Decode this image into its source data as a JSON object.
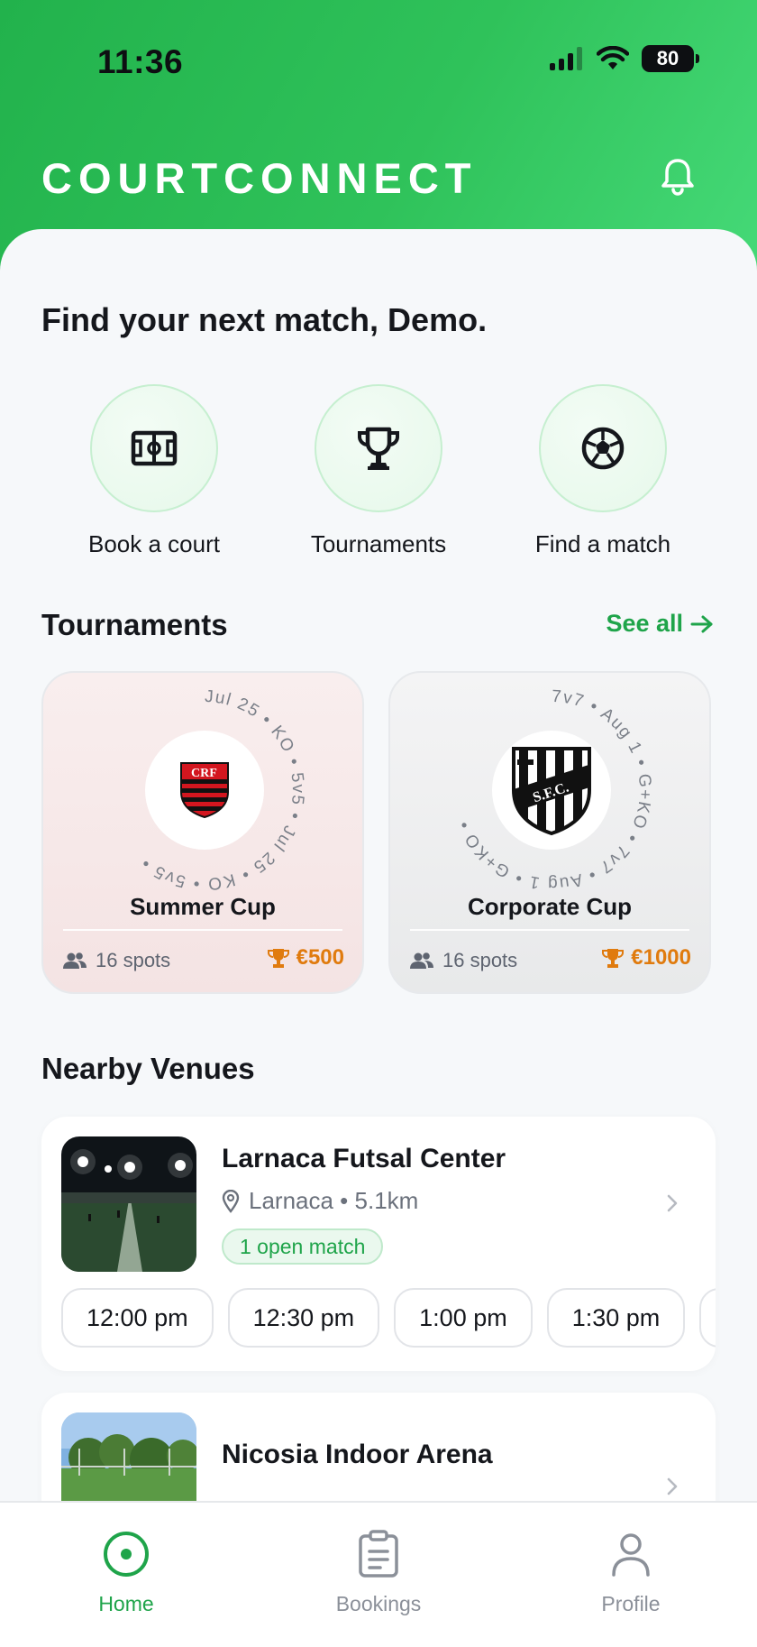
{
  "status": {
    "time": "11:36",
    "battery": "80"
  },
  "header": {
    "brand": "COURTCONNECT"
  },
  "greeting": "Find your next match, Demo.",
  "quick_actions": [
    {
      "label": "Book a court",
      "icon": "pitch-icon"
    },
    {
      "label": "Tournaments",
      "icon": "trophy-icon"
    },
    {
      "label": "Find a match",
      "icon": "soccer-ball-icon"
    }
  ],
  "tournaments_section": {
    "title": "Tournaments",
    "see_all": "See all"
  },
  "tournaments": [
    {
      "name": "Summer Cup",
      "ring_text": "Jul 25 • KO • 5v5 • Jul 25 • KO • 5v5 •",
      "spots": "16 spots",
      "prize": "€500",
      "crest": "flamengo-crest"
    },
    {
      "name": "Corporate Cup",
      "ring_text": "7v7 • Aug 1 • G+KO • 7v7 • Aug 1 • G+KO •",
      "spots": "16 spots",
      "prize": "€1000",
      "crest": "santos-crest"
    }
  ],
  "venues_section": {
    "title": "Nearby Venues"
  },
  "venues": [
    {
      "name": "Larnaca Futsal Center",
      "location": "Larnaca • 5.1km",
      "badge": "1 open match",
      "slots": [
        "12:00 pm",
        "12:30 pm",
        "1:00 pm",
        "1:30 pm",
        ""
      ]
    },
    {
      "name": "Nicosia Indoor Arena"
    }
  ],
  "tabs": [
    {
      "label": "Home",
      "active": true
    },
    {
      "label": "Bookings",
      "active": false
    },
    {
      "label": "Profile",
      "active": false
    }
  ],
  "colors": {
    "brand_green": "#22b24c",
    "accent_green": "#1fa44a",
    "prize_orange": "#e07b0e"
  }
}
